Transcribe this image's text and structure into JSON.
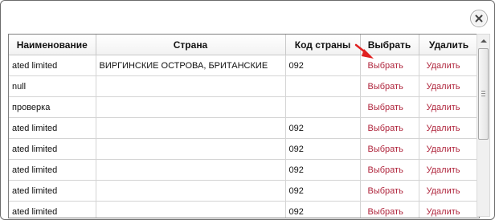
{
  "dialog": {
    "close_label": "×"
  },
  "table": {
    "headers": [
      "Наименование",
      "Страна",
      "Код страны",
      "Выбрать",
      "Удалить"
    ],
    "rows": [
      {
        "name": "ated limited",
        "country": "ВИРГИНСКИЕ ОСТРОВА, БРИТАНСКИЕ",
        "code": "092",
        "select": "Выбрать",
        "delete": "Удалить"
      },
      {
        "name": "null",
        "country": "",
        "code": "",
        "select": "Выбрать",
        "delete": "Удалить"
      },
      {
        "name": "проверка",
        "country": "",
        "code": "",
        "select": "Выбрать",
        "delete": "Удалить"
      },
      {
        "name": "ated limited",
        "country": "",
        "code": "092",
        "select": "Выбрать",
        "delete": "Удалить"
      },
      {
        "name": "ated limited",
        "country": "",
        "code": "092",
        "select": "Выбрать",
        "delete": "Удалить"
      },
      {
        "name": "ated limited",
        "country": "",
        "code": "092",
        "select": "Выбрать",
        "delete": "Удалить"
      },
      {
        "name": "ated limited",
        "country": "",
        "code": "092",
        "select": "Выбрать",
        "delete": "Удалить"
      },
      {
        "name": "ated limited",
        "country": "",
        "code": "092",
        "select": "Выбрать",
        "delete": "Удалить"
      }
    ]
  },
  "colors": {
    "link": "#b0263d",
    "pointer_arrow": "#e02020"
  },
  "icons": {
    "close": "close-icon",
    "pointer": "red-arrow-icon",
    "scroll_up": "chevron-up-icon"
  }
}
